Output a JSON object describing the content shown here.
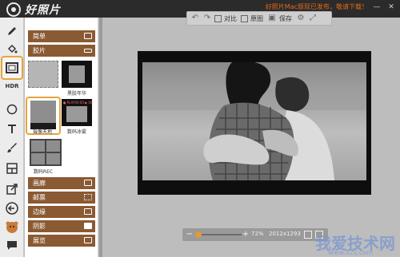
{
  "app": {
    "title": "好照片",
    "notice": "好照片Mac版现已发布，敬请下载！"
  },
  "window_controls": {
    "minimize": "—",
    "close": "✕"
  },
  "rail": {
    "hdr_label": "HDR"
  },
  "panel": {
    "categories": [
      {
        "label": "简单"
      },
      {
        "label": "胶片"
      },
      {
        "label": "画廊"
      },
      {
        "label": "邮票"
      },
      {
        "label": "边缘"
      },
      {
        "label": "阴影"
      },
      {
        "label": "展览"
      }
    ],
    "thumbs": [
      {
        "label": ""
      },
      {
        "label": "黑胶年华"
      },
      {
        "label": "摄像天地"
      },
      {
        "label": "数码冰雾"
      },
      {
        "label": "数码REC"
      }
    ],
    "rec_badge": "● PLAY00:00 ▶ 00"
  },
  "toolbar": {
    "compare": "对比",
    "original": "原图",
    "save": "保存"
  },
  "zoom": {
    "value": "72%",
    "dimensions": "2012x1293"
  },
  "watermark": {
    "main": "我爱技术网",
    "sub": "www.52ij.com"
  }
}
